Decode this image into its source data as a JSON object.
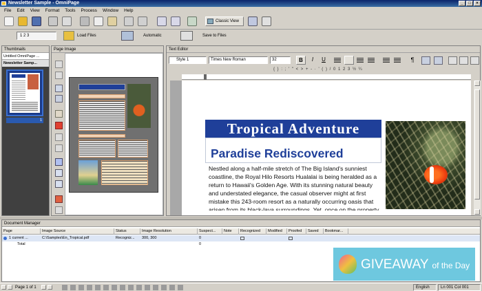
{
  "window": {
    "title": "Newsletter Sample - OmniPage",
    "controls": [
      "_",
      "□",
      "×"
    ]
  },
  "menu": [
    "File",
    "Edit",
    "View",
    "Format",
    "Tools",
    "Process",
    "Window",
    "Help"
  ],
  "toolbar": {
    "classic_view": "Classic View",
    "page_steps": "1 2 3",
    "load_files": "Load Files",
    "automatic": "Automatic",
    "save_to_files": "Save to Files"
  },
  "thumbnails": {
    "pane_title": "Thumbnails",
    "batch_name": "Untitled OmniPage ...",
    "doc_name": "Newsletter Samp...",
    "page_number": "1"
  },
  "page_image": {
    "pane_title": "Page Image"
  },
  "text_editor": {
    "pane_title": "Text Editor",
    "style": "Style 1",
    "font": "Times New Roman",
    "size": "32",
    "headline": "Tropical Adventure",
    "subhead": "Paradise Rediscovered",
    "body": "Nestled along a half-mile stretch of The Big Island's sunniest coastline, the Royal Hilo Resorts Hualalai is being heralded as a return to Hawaii's Golden Age. With its stunning natural beauty and understated elegance, the casual observer might at first mistake this 243-room resort as a naturally occurring oasis that arisen from its black-lava surroundings. Yet, once on the property, the warm, personal service and attention to detail"
  },
  "document_manager": {
    "pane_title": "Document Manager",
    "columns": [
      "Page",
      "Image Source",
      "Status",
      "Image Resolution",
      "Suspect...",
      "Note",
      "Recognized",
      "Modified",
      "Proofed",
      "Saved",
      "Bookmar..."
    ],
    "rows": [
      {
        "page": "1 current ...",
        "source": "C:\\Samples\\En_Tropical.pdf",
        "status": "Recogniz...",
        "resolution": "300, 300",
        "suspect": "0"
      },
      {
        "page": "Total",
        "source": "",
        "status": "",
        "resolution": "",
        "suspect": "0"
      }
    ]
  },
  "status": {
    "page": "Page 1 of 1",
    "language": "English",
    "position": "Ln 001 Col 001"
  },
  "watermark": {
    "text_main": "GIVEAWAY",
    "text_sub": "of the Day"
  },
  "colors": {
    "headline_bar": "#1f3f99",
    "subhead_text": "#1f3f99",
    "title_blue": "#0a246a"
  }
}
